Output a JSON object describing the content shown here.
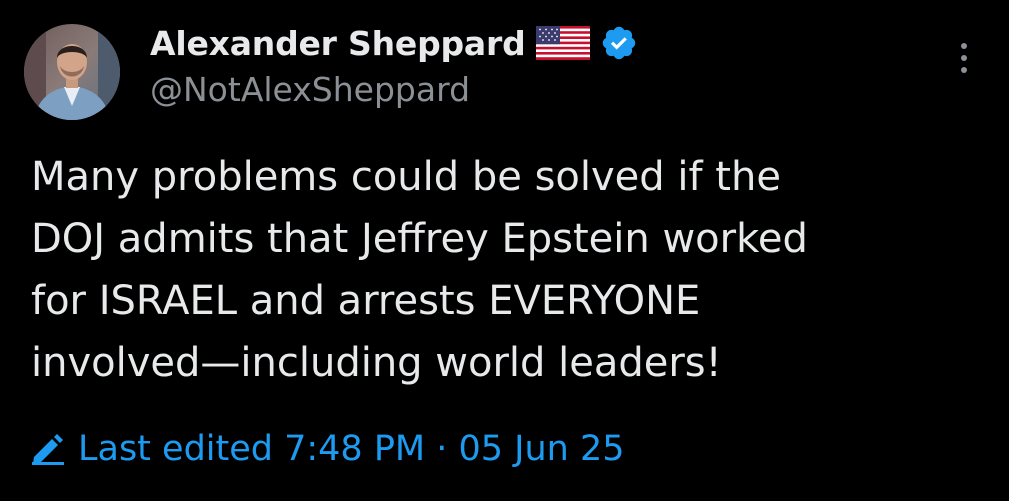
{
  "author": {
    "display_name": "Alexander Sheppard",
    "handle": "@NotAlexSheppard",
    "flag_icon": "us-flag-icon",
    "verified_icon": "verified-badge-icon",
    "verified_color": "#1d9bf0"
  },
  "menu": {
    "icon": "more-vertical-icon"
  },
  "tweet": {
    "text_lines": [
      "Many problems could be solved if the",
      "DOJ admits that Jeffrey Epstein worked",
      "for ISRAEL and arrests EVERYONE",
      "involved—including world leaders!"
    ]
  },
  "edit_info": {
    "icon": "pencil-icon",
    "label": "Last edited 7:48 PM · 05 Jun 25",
    "color": "#1d9bf0"
  },
  "colors": {
    "background": "#000000",
    "text_primary": "#e7e9ea",
    "text_secondary": "#8b9096",
    "accent": "#1d9bf0"
  }
}
